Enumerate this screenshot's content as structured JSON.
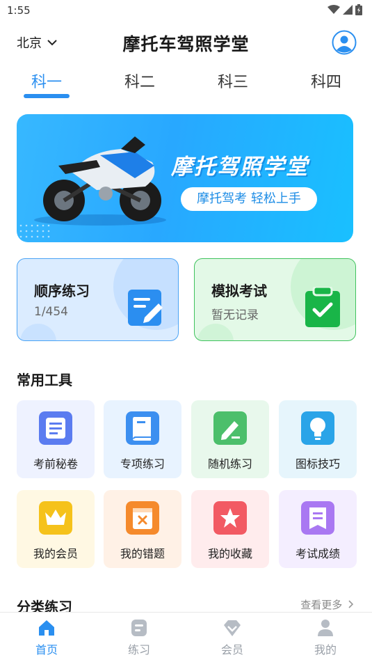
{
  "status_bar": {
    "time": "1:55",
    "icons": [
      "wifi-icon",
      "signal-icon",
      "battery-icon"
    ]
  },
  "header": {
    "city": "北京",
    "title": "摩托车驾照学堂",
    "avatar_icon": "user-avatar-icon"
  },
  "tabs": [
    {
      "label": "科一",
      "active": true
    },
    {
      "label": "科二",
      "active": false
    },
    {
      "label": "科三",
      "active": false
    },
    {
      "label": "科四",
      "active": false
    }
  ],
  "banner": {
    "title": "摩托驾照学堂",
    "subtitle": "摩托驾考 轻松上手"
  },
  "practice_cards": {
    "sequential": {
      "title": "顺序练习",
      "subtitle": "1/454",
      "icon": "edit-note-icon"
    },
    "mock_exam": {
      "title": "模拟考试",
      "subtitle": "暂无记录",
      "icon": "clipboard-check-icon"
    }
  },
  "tools": {
    "title": "常用工具",
    "items": [
      {
        "label": "考前秘卷",
        "icon": "scroll-icon",
        "color": "#5b7cf0"
      },
      {
        "label": "专项练习",
        "icon": "book-icon",
        "color": "#3c8ff0"
      },
      {
        "label": "随机练习",
        "icon": "pencil-paper-icon",
        "color": "#4cbf6b"
      },
      {
        "label": "图标技巧",
        "icon": "lightbulb-icon",
        "color": "#2aa4e8"
      },
      {
        "label": "我的会员",
        "icon": "crown-icon",
        "color": "#f5c21b"
      },
      {
        "label": "我的错题",
        "icon": "wrong-note-icon",
        "color": "#f58a2c"
      },
      {
        "label": "我的收藏",
        "icon": "star-icon",
        "color": "#f25a63"
      },
      {
        "label": "考试成绩",
        "icon": "score-sheet-icon",
        "color": "#a978f2"
      }
    ]
  },
  "categories": {
    "title": "分类练习",
    "more_label": "查看更多"
  },
  "bottom_nav": [
    {
      "label": "首页",
      "icon": "home-icon",
      "active": true
    },
    {
      "label": "练习",
      "icon": "practice-icon",
      "active": false
    },
    {
      "label": "会员",
      "icon": "diamond-icon",
      "active": false
    },
    {
      "label": "我的",
      "icon": "profile-icon",
      "active": false
    }
  ],
  "colors": {
    "primary": "#2a8ff0",
    "success": "#3fc25d",
    "muted": "#9aa0a8"
  }
}
